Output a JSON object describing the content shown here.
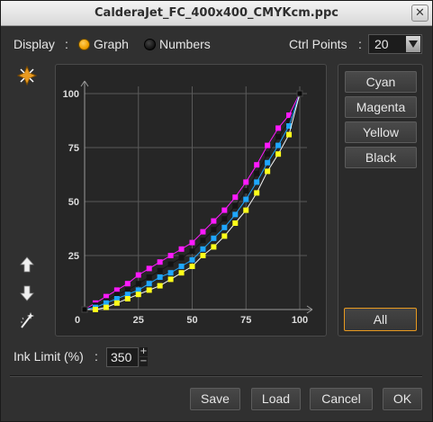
{
  "window": {
    "title": "CalderaJet_FC_400x400_CMYKcm.ppc",
    "close_glyph": "✕"
  },
  "display": {
    "label": "Display",
    "colon": ":",
    "options": [
      {
        "label": "Graph",
        "selected": true
      },
      {
        "label": "Numbers",
        "selected": false
      }
    ]
  },
  "ctrl_points": {
    "label": "Ctrl Points",
    "colon": ":",
    "value": "20"
  },
  "channels": {
    "buttons": [
      "Cyan",
      "Magenta",
      "Yellow",
      "Black"
    ],
    "all_label": "All"
  },
  "tools": {
    "top_icon": "move-handles-icon",
    "up_icon": "arrow-up-icon",
    "down_icon": "arrow-down-icon",
    "reset_icon": "magic-wand-icon"
  },
  "ink_limit": {
    "label": "Ink Limit (%)",
    "colon": ":",
    "value": "350",
    "plus": "+",
    "minus": "−"
  },
  "footer": {
    "save": "Save",
    "load": "Load",
    "cancel": "Cancel",
    "ok": "OK"
  },
  "chart_data": {
    "type": "line",
    "xlim": [
      0,
      100
    ],
    "ylim": [
      0,
      100
    ],
    "x_ticks": [
      "0",
      "25",
      "50",
      "75",
      "100"
    ],
    "y_ticks": [
      "25",
      "50",
      "75",
      "100"
    ],
    "grid": true,
    "x": [
      0,
      5,
      10,
      15,
      20,
      25,
      30,
      35,
      40,
      45,
      50,
      55,
      60,
      65,
      70,
      75,
      80,
      85,
      90,
      95,
      100
    ],
    "series": [
      {
        "color": "#ff1aff",
        "values": [
          0,
          3,
          6,
          9,
          12,
          16,
          19,
          22,
          25,
          28,
          31,
          36,
          41,
          46,
          52,
          59,
          67,
          76,
          84,
          90,
          100
        ]
      },
      {
        "color": "#141414",
        "values": [
          0,
          2,
          4,
          7,
          9,
          12,
          15,
          18,
          21,
          24,
          27,
          32,
          37,
          42,
          48,
          55,
          63,
          72,
          80,
          87,
          100
        ]
      },
      {
        "color": "#1fa7ff",
        "values": [
          0,
          1,
          3,
          5,
          7,
          9,
          12,
          15,
          17,
          20,
          23,
          28,
          33,
          38,
          44,
          51,
          59,
          68,
          76,
          85,
          100
        ]
      },
      {
        "color": "#ffff1a",
        "values": [
          0,
          0,
          1,
          3,
          5,
          7,
          9,
          11,
          14,
          17,
          20,
          25,
          29,
          34,
          40,
          46,
          54,
          64,
          72,
          81,
          100
        ]
      }
    ]
  }
}
